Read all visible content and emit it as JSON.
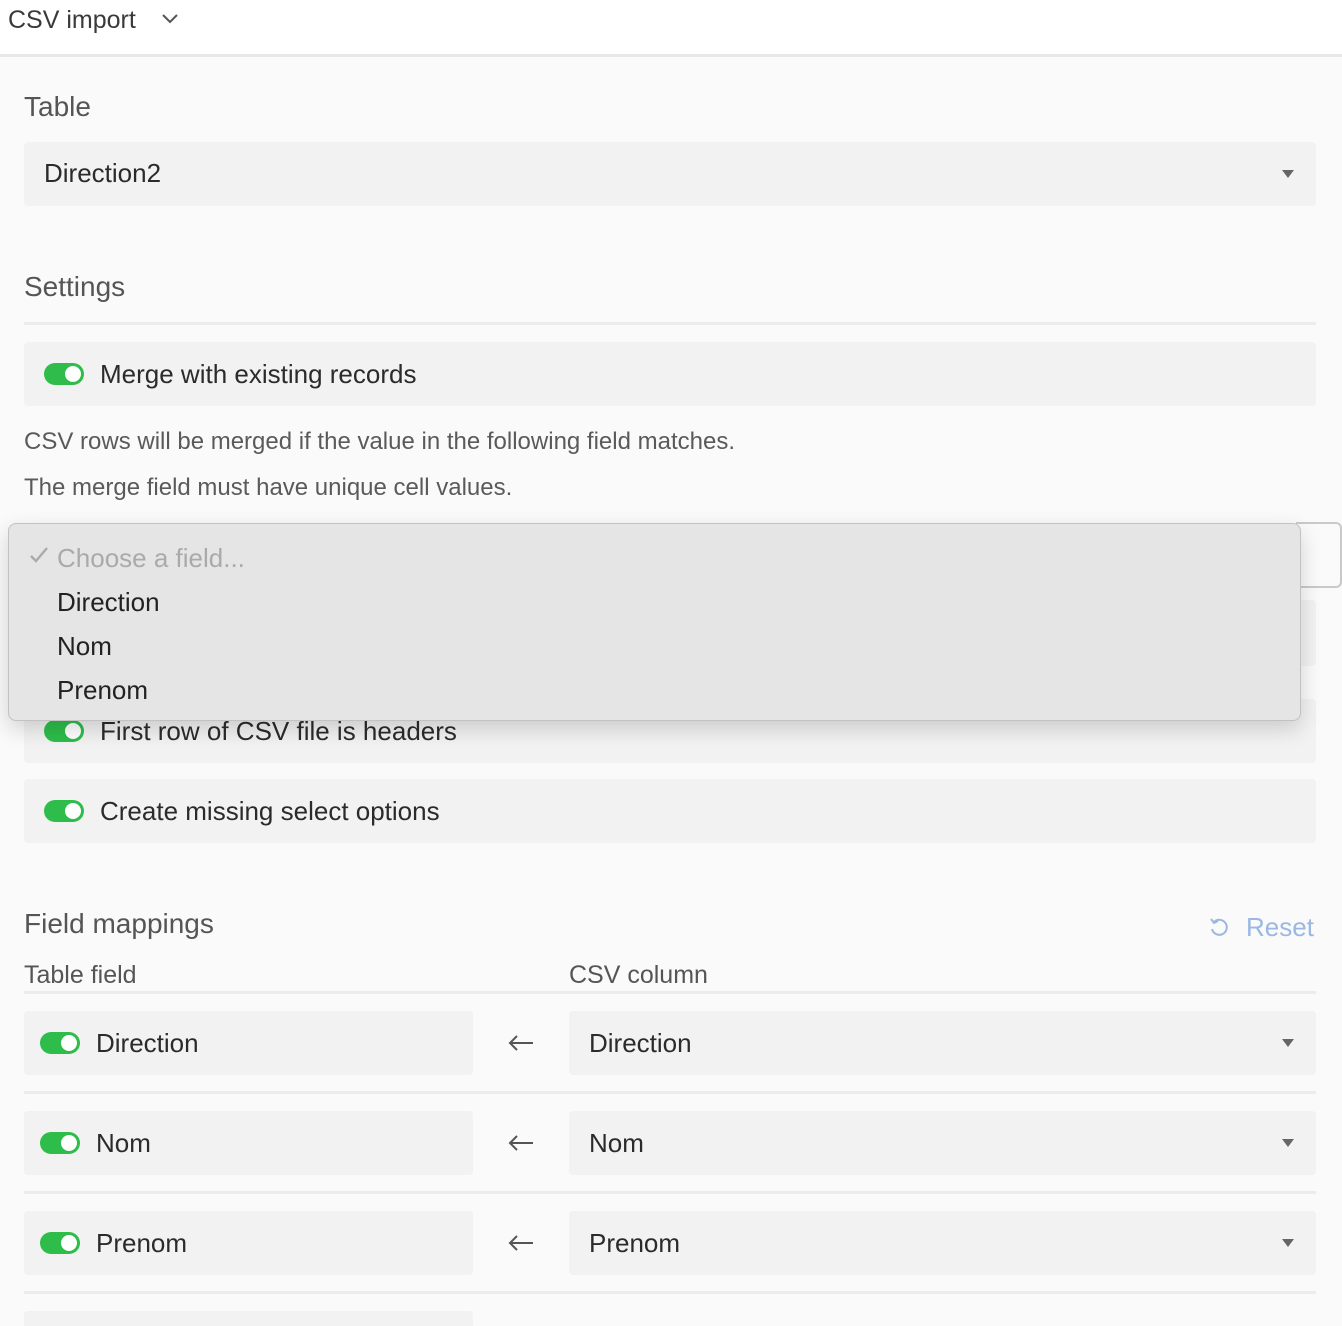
{
  "header": {
    "title": "CSV import",
    "chevron_icon": "chevron-down-icon"
  },
  "table_section": {
    "heading": "Table",
    "selected_table": "Direction2",
    "caret_icon": "caret-down-icon"
  },
  "settings": {
    "heading": "Settings",
    "merge": {
      "label": "Merge with existing records",
      "enabled": true
    },
    "helper_line_1": "CSV rows will be merged if the value in the following field matches.",
    "helper_line_2": "The merge field must have unique cell values.",
    "merge_field_menu": {
      "placeholder": "Choose a field...",
      "placeholder_checked": true,
      "options": [
        "Direction",
        "Nom",
        "Prenom"
      ]
    },
    "first_row_headers": {
      "label": "First row of CSV file is headers",
      "enabled": true
    },
    "create_options": {
      "label": "Create missing select options",
      "enabled": true
    }
  },
  "field_mappings": {
    "heading": "Field mappings",
    "reset_label": "Reset",
    "reset_icon": "reset-icon",
    "column_headers": {
      "table_field": "Table field",
      "csv_column": "CSV column"
    },
    "rows": [
      {
        "table_field": "Direction",
        "csv_column": "Direction",
        "enabled": true
      },
      {
        "table_field": "Nom",
        "csv_column": "Nom",
        "enabled": true
      },
      {
        "table_field": "Prenom",
        "csv_column": "Prenom",
        "enabled": true
      }
    ]
  },
  "colors": {
    "toggle_on": "#2ebd4a",
    "reset_link": "#9ab8e2",
    "field_bg": "#f2f2f2"
  }
}
